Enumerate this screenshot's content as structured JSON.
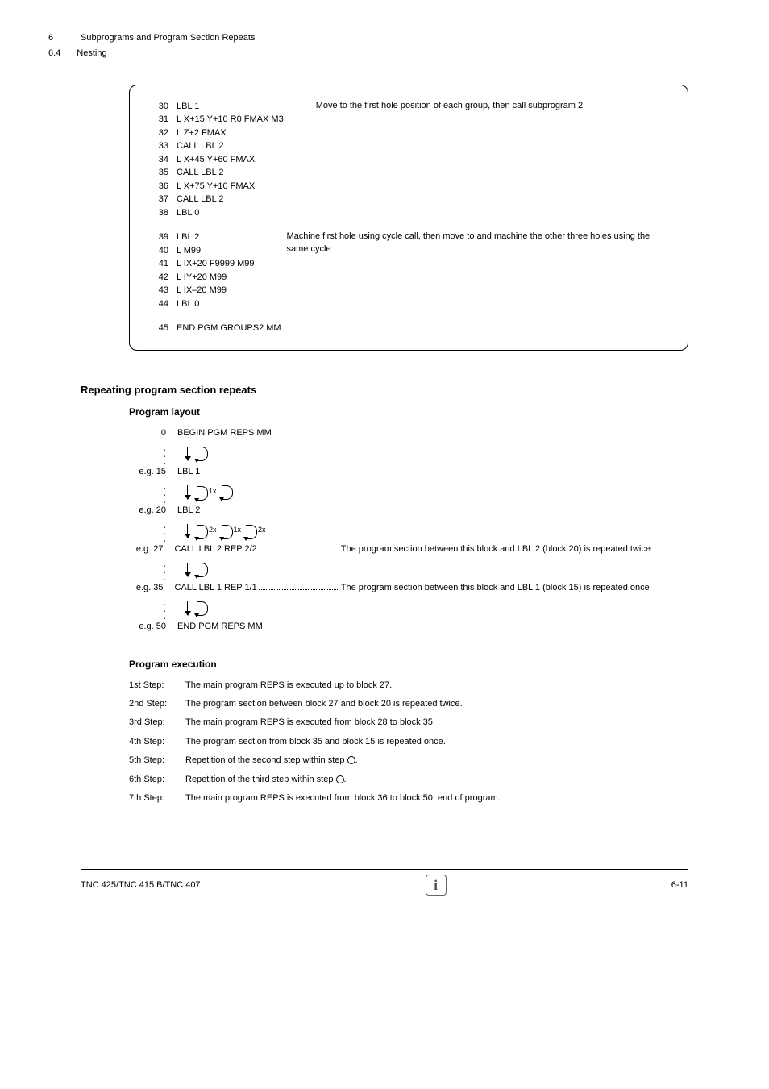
{
  "header": {
    "chapter_num": "6",
    "chapter_title": "Subprograms and Program Section Repeats",
    "section_num": "6.4",
    "section_title": "Nesting"
  },
  "code_block1": {
    "lines": [
      {
        "n": "30",
        "t": "LBL 1"
      },
      {
        "n": "31",
        "t": "L X+15 Y+10 R0 FMAX M3"
      },
      {
        "n": "32",
        "t": "L Z+2 FMAX"
      },
      {
        "n": "33",
        "t": "CALL LBL 2"
      },
      {
        "n": "34",
        "t": "L X+45 Y+60 FMAX"
      },
      {
        "n": "35",
        "t": "CALL LBL 2"
      },
      {
        "n": "36",
        "t": "L X+75 Y+10 FMAX"
      },
      {
        "n": "37",
        "t": "CALL LBL 2"
      },
      {
        "n": "38",
        "t": "LBL 0"
      }
    ],
    "desc": "Move to the first hole position of each group, then call subprogram 2"
  },
  "code_block2": {
    "lines": [
      {
        "n": "39",
        "t": "LBL 2"
      },
      {
        "n": "40",
        "t": "L M99"
      },
      {
        "n": "41",
        "t": "L IX+20 F9999 M99"
      },
      {
        "n": "42",
        "t": "L IY+20 M99"
      },
      {
        "n": "43",
        "t": "L IX–20 M99"
      },
      {
        "n": "44",
        "t": "LBL 0"
      }
    ],
    "desc": "Machine first hole using cycle call, then move to and machine the other three holes using the same cycle"
  },
  "code_end": {
    "n": "45",
    "t": "END PGM GROUPS2 MM"
  },
  "heading": "Repeating program section repeats",
  "layout_heading": "Program layout",
  "layout": {
    "l0": {
      "n": "0",
      "t": "BEGIN PGM REPS MM"
    },
    "l15": {
      "n": "e.g. 15",
      "t": "LBL 1",
      "m": "1x"
    },
    "l20": {
      "n": "e.g. 20",
      "t": "LBL 2",
      "m1": "2x",
      "m2": "1x",
      "m3": "2x"
    },
    "l27": {
      "n": "e.g. 27",
      "t": "CALL LBL 2 REP 2/2",
      "d": "The program section between this block and  LBL 2 (block 20) is repeated twice"
    },
    "l27d2": "is repeated twice",
    "l35": {
      "n": "e.g. 35",
      "t": "CALL LBL 1 REP 1/1",
      "d": "The program section between this block and LBL 1 (block 15) is repeated once"
    },
    "l35d2": "is repeated once",
    "l50": {
      "n": "e.g. 50",
      "t": "END PGM REPS MM"
    }
  },
  "exec_heading": "Program execution",
  "exec": [
    {
      "s": "1st Step:",
      "t": "The main program REPS is executed up to block 27."
    },
    {
      "s": "2nd Step:",
      "t": "The program section between block 27 and block 20 is repeated twice."
    },
    {
      "s": "3rd Step:",
      "t": "The main program REPS is executed from block 28 to block 35."
    },
    {
      "s": "4th Step:",
      "t": "The program section from block 35 and block 15 is repeated once."
    },
    {
      "s": "5th Step:",
      "t": "Repetition of the second step within step"
    },
    {
      "s": "6th Step:",
      "t": "Repetition of the third step within step"
    },
    {
      "s": "7th Step:",
      "t": "The main program REPS is executed from block 36 to block 50, end of program."
    }
  ],
  "footer": {
    "left": "TNC 425/TNC 415 B/TNC 407",
    "right": "6-11",
    "info": "i"
  }
}
